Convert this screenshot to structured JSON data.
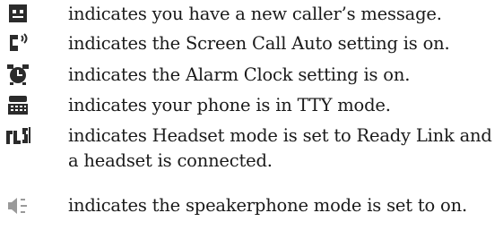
{
  "legend": {
    "rows": [
      {
        "icon": "new-caller-message-icon",
        "text": "indicates you have a new caller’s message."
      },
      {
        "icon": "screen-call-auto-icon",
        "text": "indicates the Screen Call Auto setting is on."
      },
      {
        "icon": "alarm-clock-icon",
        "text": "indicates the Alarm Clock setting is on."
      },
      {
        "icon": "tty-mode-icon",
        "text": "indicates your phone is in TTY mode."
      },
      {
        "icon": "ready-link-headset-icon",
        "text": "indicates Headset mode is set to Ready Link and a headset is connected."
      },
      {
        "icon": "speakerphone-icon",
        "text": "indicates the speakerphone mode is set to on."
      }
    ]
  },
  "colors": {
    "icon": "#2b2b2b",
    "icon_light": "#9a9a9a",
    "text": "#1a1a1a"
  }
}
